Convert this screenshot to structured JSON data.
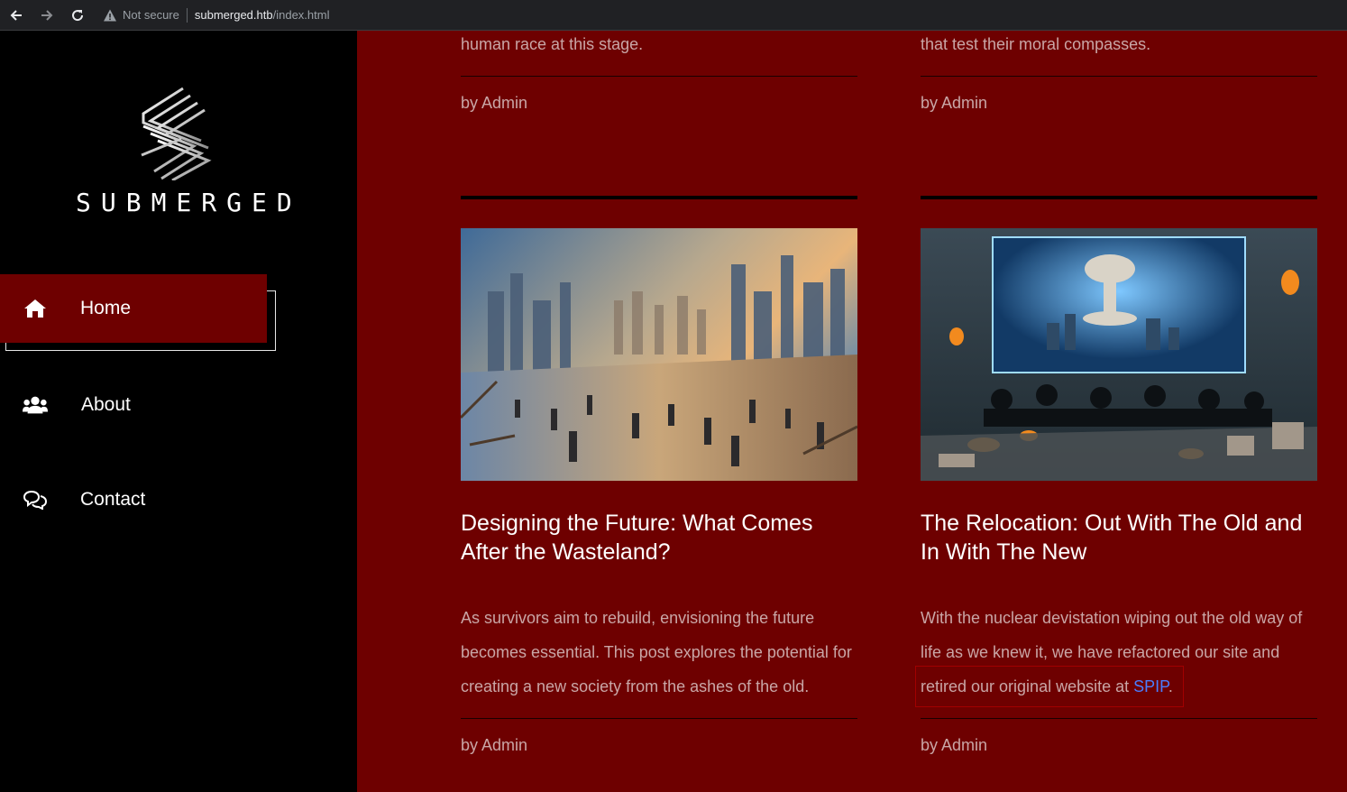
{
  "browser": {
    "security_label": "Not secure",
    "url_host": "submerged.htb",
    "url_path": "/index.html"
  },
  "sidebar": {
    "logo_text": "SUBMERGED",
    "nav": [
      {
        "label": "Home",
        "icon": "home-icon",
        "active": true
      },
      {
        "label": "About",
        "icon": "users-icon",
        "active": false
      },
      {
        "label": "Contact",
        "icon": "chat-icon",
        "active": false
      }
    ]
  },
  "main": {
    "previous_posts": [
      {
        "excerpt_tail": "human race at this stage.",
        "byline": "by Admin"
      },
      {
        "excerpt_tail": "that test their moral compasses.",
        "byline": "by Admin"
      }
    ],
    "posts": [
      {
        "title": "Designing the Future: What Comes After the Wasteland?",
        "excerpt": "As survivors aim to rebuild, envisioning the future becomes essential. This post explores the potential for creating a new society from the ashes of the old.",
        "byline": "by Admin"
      },
      {
        "title": "The Relocation: Out With The Old and In With The New",
        "excerpt_before_link": "With the nuclear devistation wiping out the old way of life as we knew it, we have refactored our site and retired our original website at ",
        "link_text": "SPIP",
        "excerpt_after_link": ".",
        "byline": "by Admin"
      }
    ]
  },
  "colors": {
    "main_background": "#6e0000",
    "sidebar_background": "#000000",
    "active_nav": "#6e0000",
    "link": "#4a7dff",
    "muted_text": "#c9a6a6"
  }
}
